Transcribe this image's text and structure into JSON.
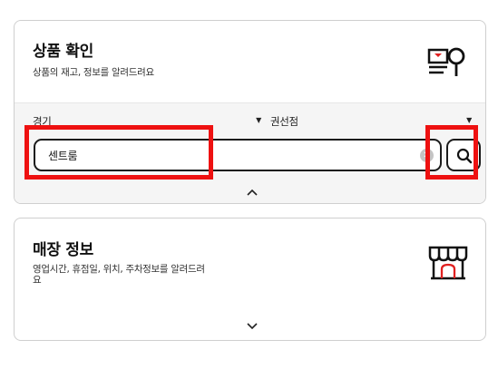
{
  "product_card": {
    "title": "상품 확인",
    "description": "상품의 재고, 정보를 알려드려요",
    "icon": "product-search-icon",
    "region_select": {
      "value": "경기",
      "icon": "caret-down-icon"
    },
    "store_select": {
      "value": "권선점",
      "icon": "caret-down-icon"
    },
    "search": {
      "value": "센트룸",
      "clear_icon": "clear-icon",
      "search_icon": "search-icon"
    },
    "collapse_icon": "chevron-up-icon"
  },
  "store_card": {
    "title": "매장 정보",
    "description": "영업시간, 휴점일, 위치, 주차정보를 알려드려요",
    "icon": "storefront-icon",
    "expand_icon": "chevron-down-icon"
  },
  "colors": {
    "highlight": "#ee1111",
    "accent_red": "#e02020",
    "text": "#111111",
    "band": "#f5f5f5"
  }
}
